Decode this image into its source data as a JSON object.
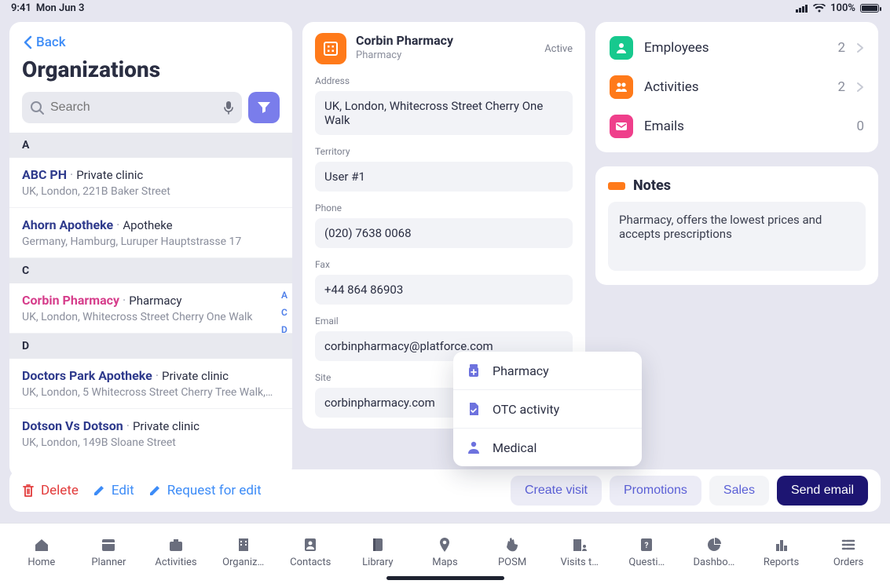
{
  "status_bar": {
    "time": "9:41",
    "date": "Mon Jun 3",
    "battery_text": "100%"
  },
  "left": {
    "back": "Back",
    "title": "Organizations",
    "search_placeholder": "Search",
    "alpha_index": [
      "A",
      "C",
      "D"
    ],
    "sections": [
      {
        "letter": "A",
        "items": [
          {
            "name": "ABC PH",
            "type": "Private clinic",
            "addr": "UK, London, 221B Baker Street"
          },
          {
            "name": "Ahorn Apotheke",
            "type": "Apotheke",
            "addr": "Germany, Hamburg, Luruper Hauptstrasse 17"
          }
        ]
      },
      {
        "letter": "C",
        "items": [
          {
            "name": "Corbin Pharmacy",
            "type": "Pharmacy",
            "addr": "UK, London, Whitecross Street Cherry One Walk",
            "selected": true
          }
        ]
      },
      {
        "letter": "D",
        "items": [
          {
            "name": "Doctors Park Apotheke",
            "type": "Private clinic",
            "addr": "UK, London, 5 Whitecross Street Cherry Tree Walk,…"
          },
          {
            "name": "Dotson Vs Dotson",
            "type": "Private clinic",
            "addr": "UK, London, 149B Sloane Street"
          }
        ]
      }
    ]
  },
  "details": {
    "name": "Corbin Pharmacy",
    "subtitle": "Pharmacy",
    "status": "Active",
    "fields": {
      "address_label": "Address",
      "address": "UK, London, Whitecross Street Cherry One Walk",
      "territory_label": "Territory",
      "territory": "User #1",
      "phone_label": "Phone",
      "phone": "(020) 7638 0068",
      "fax_label": "Fax",
      "fax": "+44 864 86903",
      "email_label": "Email",
      "email": "corbinpharmacy@platforce.com",
      "site_label": "Site",
      "site": "corbinpharmacy.com"
    }
  },
  "popover": {
    "pharmacy": "Pharmacy",
    "otc": "OTC activity",
    "medical": "Medical"
  },
  "right": {
    "employees_label": "Employees",
    "employees_count": "2",
    "activities_label": "Activities",
    "activities_count": "2",
    "emails_label": "Emails",
    "emails_count": "0",
    "notes_title": "Notes",
    "notes_text": "Pharmacy, offers the lowest prices and accepts prescriptions"
  },
  "actions": {
    "delete": "Delete",
    "edit": "Edit",
    "request": "Request for edit",
    "create_visit": "Create visit",
    "promotions": "Promotions",
    "sales": "Sales",
    "send_email": "Send email"
  },
  "tabs": {
    "home": "Home",
    "planner": "Planner",
    "activities": "Activities",
    "organizations": "Organiz…",
    "contacts": "Contacts",
    "library": "Library",
    "maps": "Maps",
    "posm": "POSM",
    "visits": "Visits t…",
    "questionnaires": "Questi…",
    "dashboard": "Dashbo…",
    "reports": "Reports",
    "orders": "Orders"
  }
}
